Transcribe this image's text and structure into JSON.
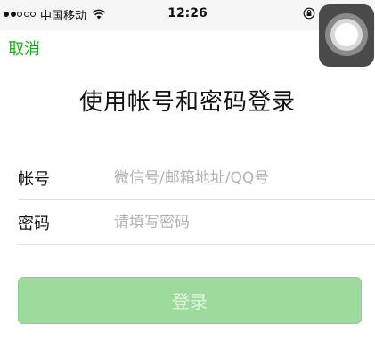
{
  "status_bar": {
    "carrier": "中国移动",
    "time": "12:26",
    "signal_icon": "signal-dots-icon",
    "wifi_icon": "wifi-icon",
    "lock_icon": "orientation-lock-icon"
  },
  "nav": {
    "cancel_label": "取消"
  },
  "title": "使用帐号和密码登录",
  "form": {
    "account_label": "帐号",
    "account_placeholder": "微信号/邮箱地址/QQ号",
    "password_label": "密码",
    "password_placeholder": "请填写密码"
  },
  "login_button_label": "登录",
  "colors": {
    "accent": "#1aad19",
    "button_disabled": "#9ed99d",
    "link": "#576b95"
  }
}
